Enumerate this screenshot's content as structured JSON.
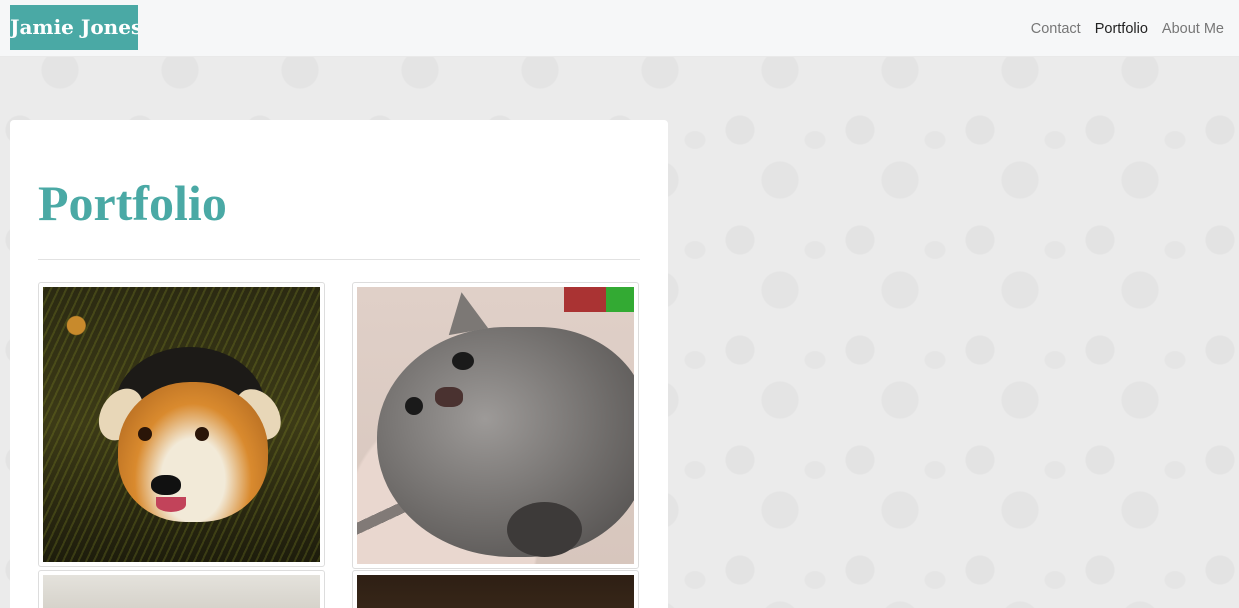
{
  "navbar": {
    "brand": "Jamie Jones",
    "links": [
      {
        "label": "Contact",
        "active": false
      },
      {
        "label": "Portfolio",
        "active": true
      },
      {
        "label": "About Me",
        "active": false
      }
    ]
  },
  "main": {
    "title": "Portfolio",
    "gallery": [
      {
        "subject": "dog photo"
      },
      {
        "subject": "kitten photo"
      },
      {
        "subject": "photo (partially visible)"
      },
      {
        "subject": "photo (partially visible)"
      }
    ]
  },
  "colors": {
    "accent": "#4aa9a5",
    "navbar_bg": "#f6f7f8",
    "page_bg": "#ebebeb"
  }
}
